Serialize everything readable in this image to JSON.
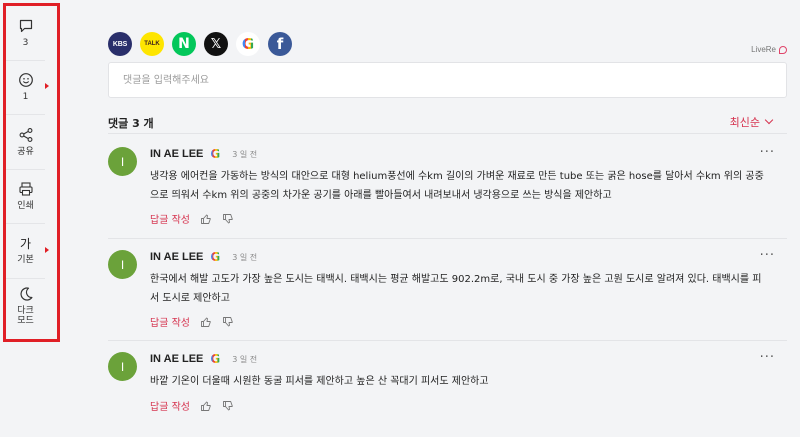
{
  "sidebar": {
    "items": [
      {
        "label": "3",
        "icon": "comment-icon"
      },
      {
        "label": "1",
        "icon": "smiley-icon"
      },
      {
        "label": "공유",
        "icon": "share-icon"
      },
      {
        "label": "인쇄",
        "icon": "print-icon"
      },
      {
        "big": "가",
        "label": "기본",
        "icon": "font-size-icon"
      },
      {
        "label": "다크\n모드",
        "icon": "moon-icon"
      }
    ],
    "highlight_color": "#e01f26"
  },
  "social": {
    "kbs": "KBS",
    "kakao": "TALK",
    "naver": "N",
    "x": "𝕏",
    "google": "G",
    "facebook": "f"
  },
  "brand": "LiveRe",
  "comment_box": {
    "placeholder": "댓글을 입력해주세요"
  },
  "comments_header": {
    "count_label": "댓글 3 개",
    "sort_label": "최신순"
  },
  "comments": [
    {
      "avatar": "I",
      "name": "IN AE LEE",
      "provider": "G",
      "time": "3 일 전",
      "more": "···",
      "body": "냉각용 에어컨을 가동하는 방식의 대안으로 대형 helium풍선에 수km 길이의 가벼운 재료로 만든 tube 또는 굵은 hose를 달아서 수km 위의 공중으로 띄워서 수km 위의 공중의 차가운 공기를 아래를 빨아들여서 내려보내서 냉각용으로 쓰는 방식을 제안하고",
      "reply": "답글 작성"
    },
    {
      "avatar": "I",
      "name": "IN AE LEE",
      "provider": "G",
      "time": "3 일 전",
      "more": "···",
      "body": "한국에서 해발 고도가 가장 높은 도시는 태백시. 태백시는 평균 해발고도 902.2m로, 국내 도시 중 가장 높은 고원 도시로 알려져 있다. 태백시를 피서 도시로 제안하고",
      "reply": "답글 작성"
    },
    {
      "avatar": "I",
      "name": "IN AE LEE",
      "provider": "G",
      "time": "3 일 전",
      "more": "···",
      "body": "바깥 기온이 더울때 시원한 동굴 피서를 제안하고 높은 산 꼭대기 피서도 제안하고",
      "reply": "답글 작성"
    }
  ]
}
